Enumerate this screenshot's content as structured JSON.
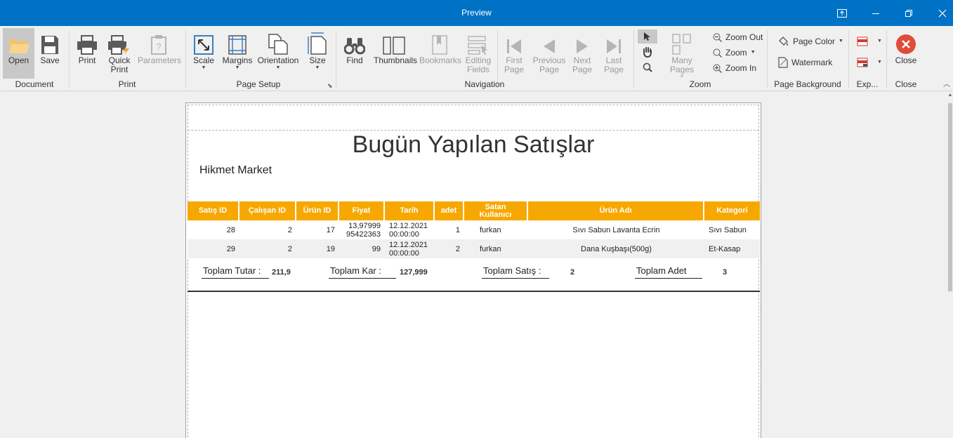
{
  "window": {
    "title": "Preview"
  },
  "ribbon": {
    "document": {
      "group": "Document",
      "open": "Open",
      "save": "Save"
    },
    "print": {
      "group": "Print",
      "print": "Print",
      "quick_print": "Quick\nPrint",
      "parameters": "Parameters"
    },
    "page_setup": {
      "group": "Page Setup",
      "scale": "Scale",
      "margins": "Margins",
      "orientation": "Orientation",
      "size": "Size"
    },
    "navigation": {
      "group": "Navigation",
      "find": "Find",
      "thumbnails": "Thumbnails",
      "bookmarks": "Bookmarks",
      "editing_fields": "Editing\nFields",
      "first_page": "First\nPage",
      "previous_page": "Previous\nPage",
      "next_page": "Next\nPage",
      "last_page": "Last\nPage"
    },
    "zoom": {
      "group": "Zoom",
      "many_pages": "Many Pages",
      "zoom_out": "Zoom Out",
      "zoom": "Zoom",
      "zoom_in": "Zoom In"
    },
    "page_background": {
      "group": "Page Background",
      "page_color": "Page Color",
      "watermark": "Watermark"
    },
    "export": {
      "group": "Exp..."
    },
    "close": {
      "group": "Close",
      "close": "Close"
    }
  },
  "report": {
    "title": "Bugün Yapılan Satışlar",
    "company": "Hikmet Market",
    "columns": [
      "Satış ID",
      "Çalışan ID",
      "Ürün ID",
      "Fiyat",
      "Tarih",
      "adet",
      "Satan\nKullanıcı",
      "Ürün Adı",
      "Kategori"
    ],
    "rows": [
      {
        "satis_id": "28",
        "calisan_id": "2",
        "urun_id": "17",
        "fiyat": "13,97999\n95422363",
        "tarih": "12.12.2021\n00:00:00",
        "adet": "1",
        "satan": "furkan",
        "urun_adi": "Sıvı Sabun Lavanta Ecrin",
        "kategori": "Sıvı Sabun"
      },
      {
        "satis_id": "29",
        "calisan_id": "2",
        "urun_id": "19",
        "fiyat": "99",
        "tarih": "12.12.2021\n00:00:00",
        "adet": "2",
        "satan": "furkan",
        "urun_adi": "Dana Kuşbaşı(500g)",
        "kategori": "Et-Kasap"
      }
    ],
    "totals": {
      "toplam_tutar_label": "Toplam Tutar :",
      "toplam_tutar": "211,9",
      "toplam_kar_label": "Toplam Kar :",
      "toplam_kar": "127,999",
      "toplam_satis_label": "Toplam Satış :",
      "toplam_satis": "2",
      "toplam_adet_label": "Toplam Adet",
      "toplam_adet": "3"
    }
  },
  "colors": {
    "titlebar": "#0072c6",
    "table_header": "#f6a800",
    "alt_row": "#f0f0f0",
    "close_red": "#e04b3a"
  }
}
